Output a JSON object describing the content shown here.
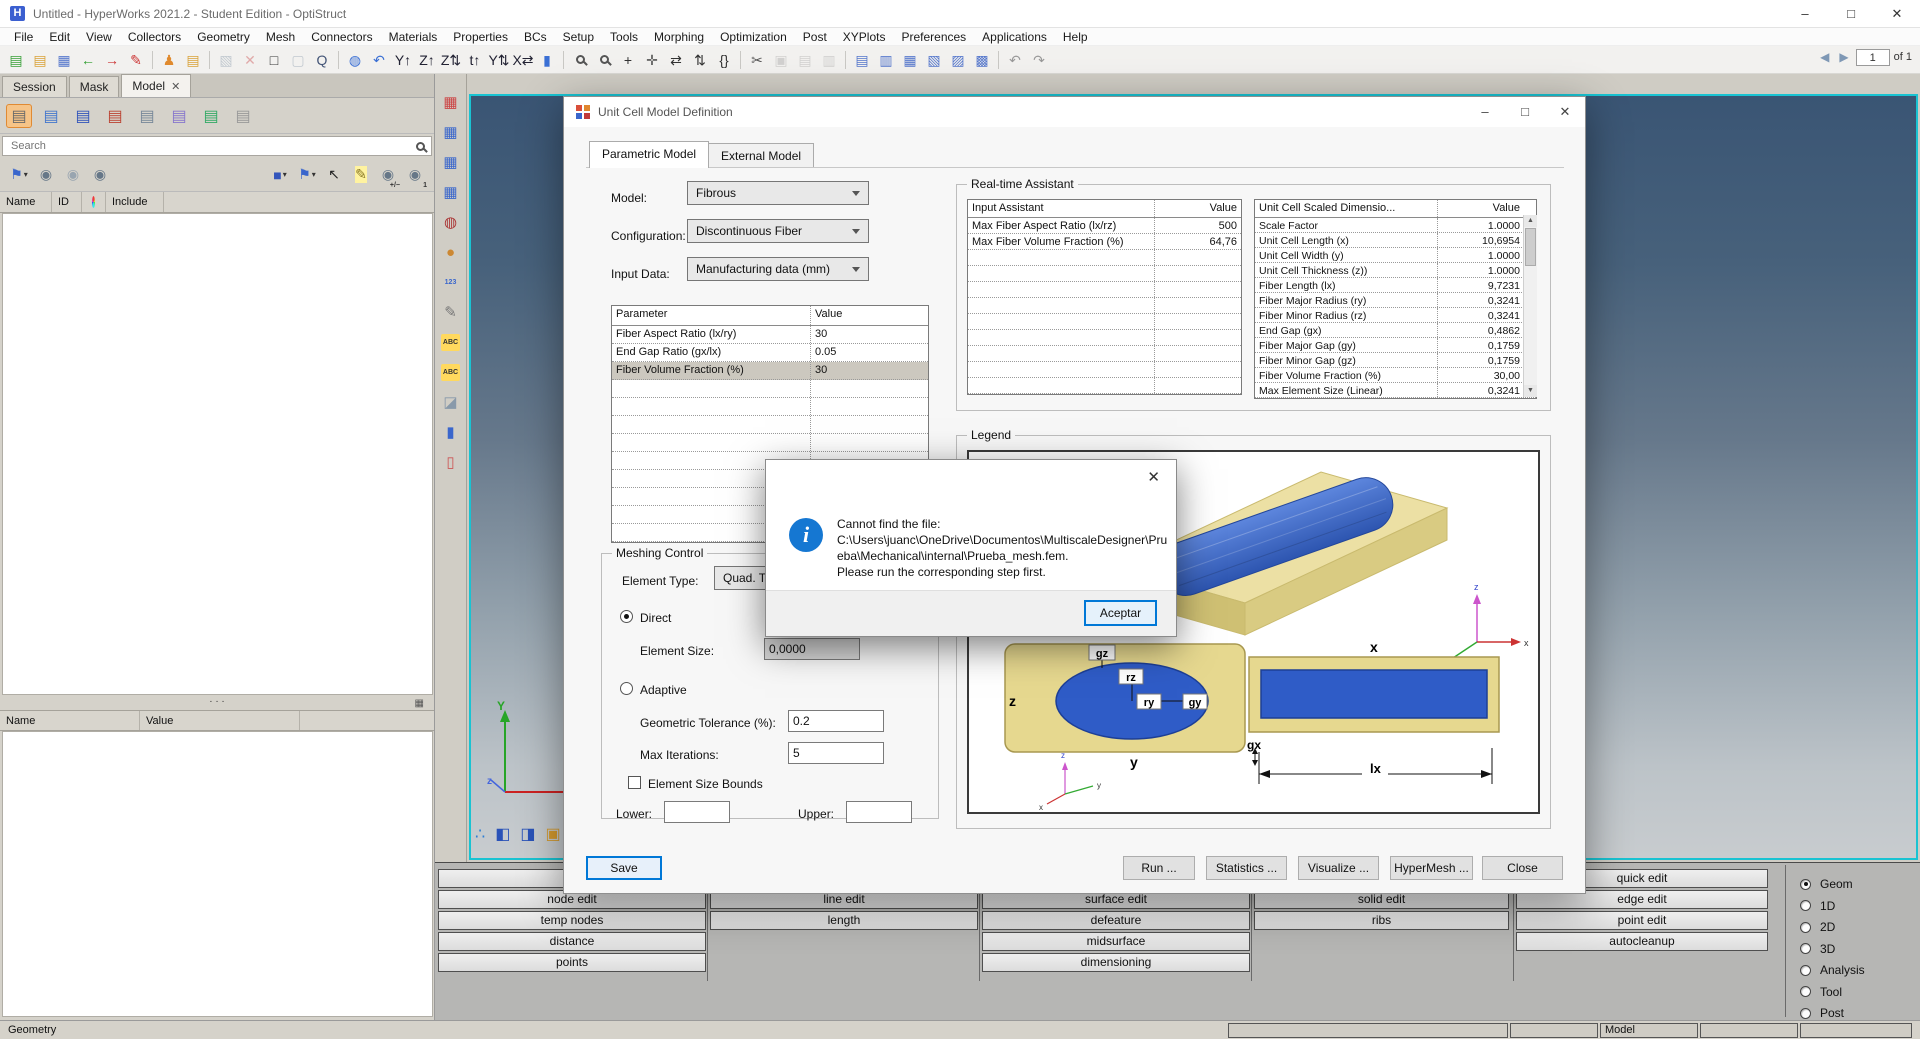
{
  "colors": {
    "accent_cyan": "#19c3d2",
    "focus_blue": "#0078d7",
    "info_blue": "#1577d2",
    "legend_yellow": "#e6d88f",
    "legend_blue": "#2f5cc7"
  },
  "window": {
    "title": "Untitled - HyperWorks 2021.2 - Student Edition - OptiStruct",
    "app_icon_glyph": "H",
    "controls": {
      "minimize": "–",
      "maximize": "□",
      "close": "✕"
    }
  },
  "menu": [
    "File",
    "Edit",
    "View",
    "Collectors",
    "Geometry",
    "Mesh",
    "Connectors",
    "Materials",
    "Properties",
    "BCs",
    "Setup",
    "Tools",
    "Morphing",
    "Optimization",
    "Post",
    "XYPlots",
    "Preferences",
    "Applications",
    "Help"
  ],
  "toolbar": {
    "icons": [
      {
        "n": "new-session-icon",
        "g": "▤",
        "c": "#3aa13a"
      },
      {
        "n": "open-file-icon",
        "g": "▤",
        "c": "#d9a33a"
      },
      {
        "n": "save-file-icon",
        "g": "▦",
        "c": "#5577cc"
      },
      {
        "n": "import-icon",
        "g": "←",
        "c": "#2e9e2e"
      },
      {
        "n": "export-icon",
        "g": "→",
        "c": "#cc3333"
      },
      {
        "n": "export-ppt-icon",
        "g": "✎",
        "c": "#cc3333"
      },
      {
        "sep": true
      },
      {
        "n": "user-profile-icon",
        "g": "♟",
        "c": "#e08a2e"
      },
      {
        "n": "organize-icon",
        "g": "▤",
        "c": "#d9a33a"
      },
      {
        "sep": true
      },
      {
        "n": "new-window-icon",
        "g": "▧",
        "c": "#8899aa",
        "dim": true
      },
      {
        "n": "delete-icon",
        "g": "✕",
        "c": "#cc5555",
        "dim": true
      },
      {
        "n": "display-rect-icon",
        "g": "□",
        "c": "#333333"
      },
      {
        "n": "panel-layout-icon",
        "g": "▢",
        "c": "#8899aa",
        "dim": true
      },
      {
        "n": "find-entities-icon",
        "g": "Q",
        "c": "#445577"
      },
      {
        "sep": true
      },
      {
        "n": "global-view-icon",
        "g": "◍",
        "c": "#3a6fd4"
      },
      {
        "n": "view-rotate-icon",
        "g": "↶",
        "c": "#3a6fd4"
      },
      {
        "n": "axis-view-y-icon",
        "g": "Y↑",
        "c": "#223"
      },
      {
        "n": "axis-view-z-icon",
        "g": "Z↑",
        "c": "#223"
      },
      {
        "n": "axis-view-zz-icon",
        "g": "Z⇅",
        "c": "#223"
      },
      {
        "n": "axis-view-t-icon",
        "g": "t↑",
        "c": "#223"
      },
      {
        "n": "axis-view-yz-icon",
        "g": "Y⇅",
        "c": "#223"
      },
      {
        "n": "axis-view-x-icon",
        "g": "X⇄",
        "c": "#223"
      },
      {
        "n": "notes-icon",
        "g": "▮",
        "c": "#3a6fd4"
      },
      {
        "sep": true
      },
      {
        "n": "zoom-icon",
        "mag": true
      },
      {
        "n": "zoom-area-icon",
        "mag": true
      },
      {
        "n": "fit-view-icon",
        "g": "+",
        "c": "#333"
      },
      {
        "n": "pan-icon",
        "g": "✛",
        "c": "#555"
      },
      {
        "n": "arrows-horizontal-icon",
        "g": "⇄",
        "c": "#333"
      },
      {
        "n": "arrows-vertical-icon",
        "g": "⇅",
        "c": "#333"
      },
      {
        "n": "braces-icon",
        "g": "{}",
        "c": "#333"
      },
      {
        "sep": true
      },
      {
        "n": "cut-icon",
        "g": "✂",
        "c": "#555"
      },
      {
        "n": "copy-icon",
        "g": "▣",
        "c": "#aaa",
        "dim": true
      },
      {
        "n": "paste-icon",
        "g": "▤",
        "c": "#aaa",
        "dim": true
      },
      {
        "n": "paste-special-icon",
        "g": "▥",
        "c": "#aaa",
        "dim": true
      },
      {
        "sep": true
      },
      {
        "n": "layout-single-icon",
        "g": "▤",
        "c": "#5577cc"
      },
      {
        "n": "layout-two-icon",
        "g": "▥",
        "c": "#5577cc"
      },
      {
        "n": "layout-grid-icon",
        "g": "▦",
        "c": "#5577cc"
      },
      {
        "n": "layout-left-icon",
        "g": "▧",
        "c": "#5577cc"
      },
      {
        "n": "layout-right-icon",
        "g": "▨",
        "c": "#5577cc"
      },
      {
        "n": "layout-quad-icon",
        "g": "▩",
        "c": "#5577cc"
      },
      {
        "sep": true
      },
      {
        "n": "undo-icon",
        "g": "↶",
        "c": "#999"
      },
      {
        "n": "redo-icon",
        "g": "↷",
        "c": "#999"
      }
    ],
    "nav": {
      "back": "◀",
      "forward": "▶",
      "page": "1",
      "of_label": "of 1"
    }
  },
  "vstrip_icons": [
    {
      "n": "model-table-icon",
      "g": "▦",
      "c": "#cc4444"
    },
    {
      "n": "mask-table-icon",
      "g": "▦",
      "c": "#3a66cc"
    },
    {
      "n": "matrix-table-icon",
      "g": "▦",
      "c": "#3a66cc"
    },
    {
      "n": "entity-table-icon",
      "g": "▦",
      "c": "#3a66cc"
    },
    {
      "n": "contact-browser-icon",
      "g": "◍",
      "c": "#aa3333"
    },
    {
      "n": "sphere-tool-icon",
      "g": "●",
      "c": "#cc8833"
    },
    {
      "n": "info-123-icon",
      "g": "123",
      "c": "#3a66cc",
      "small": true
    },
    {
      "n": "measure-icon",
      "g": "✎",
      "c": "#777"
    },
    {
      "n": "abc-highlight-icon",
      "g": "ABC",
      "c": "#333",
      "bg": "#ffd95e",
      "small": true
    },
    {
      "n": "abc-edit-icon",
      "g": "ABC",
      "c": "#333",
      "bg": "#ffd95e",
      "small": true
    },
    {
      "n": "section-cut-icon",
      "g": "◪",
      "c": "#8899aa"
    },
    {
      "n": "solver-view-icon",
      "g": "▮",
      "c": "#3a66cc"
    },
    {
      "n": "utility-icon",
      "g": "▯",
      "c": "#cc5555"
    }
  ],
  "sidebar": {
    "tabs": [
      {
        "label": "Session",
        "active": false
      },
      {
        "label": "Mask",
        "active": false
      },
      {
        "label": "Model",
        "active": true,
        "close_glyph": "✕"
      }
    ],
    "folder_icons": [
      {
        "n": "folder-new-icon",
        "g": "▤",
        "c": "#6a6a6a",
        "sel": true
      },
      {
        "n": "folder-connections-icon",
        "g": "▤",
        "c": "#4477cc"
      },
      {
        "n": "folder-component-icon",
        "g": "▤",
        "c": "#3355bb"
      },
      {
        "n": "folder-time-icon",
        "g": "▤",
        "c": "#bb4433"
      },
      {
        "n": "folder-mesh-icon",
        "g": "▤",
        "c": "#778899"
      },
      {
        "n": "folder-spline-icon",
        "g": "▤",
        "c": "#8877cc"
      },
      {
        "n": "folder-multi-icon",
        "g": "▤",
        "c": "#33aa66"
      },
      {
        "n": "folder-stack-icon",
        "g": "▤",
        "c": "#999999"
      }
    ],
    "search_placeholder": "Search",
    "row2_icons": [
      {
        "n": "model-view-icon",
        "g": "⚑",
        "c": "#3a66cc",
        "dd": true
      },
      {
        "n": "show-checked-icon",
        "g": "◉",
        "c": "#667788"
      },
      {
        "n": "show-unchecked-icon",
        "g": "◉",
        "c": "#99a5b0"
      },
      {
        "n": "show-reverse-icon",
        "g": "◉",
        "c": "#667788"
      },
      {
        "gap": true
      },
      {
        "n": "entity-display-icon",
        "g": "■",
        "c": "#3355bb",
        "dd": true
      },
      {
        "n": "view-flag-icon",
        "g": "⚑",
        "c": "#3a66cc",
        "dd": true
      },
      {
        "n": "pointer-icon",
        "g": "↖",
        "c": "#222"
      },
      {
        "n": "highlight-pen-icon",
        "g": "✎",
        "c": "#887722",
        "bg": "#fff3a0"
      },
      {
        "n": "show-hide-icon",
        "g": "◉",
        "c": "#667788",
        "sub": "+/−"
      },
      {
        "n": "isolate-one-icon",
        "g": "◉",
        "c": "#667788",
        "sub": "1"
      }
    ],
    "tree_headers": {
      "name": "Name",
      "id": "ID",
      "include": "Include"
    },
    "splitter_dots": "· · ·",
    "splitter_icon": "▦",
    "prop_headers": {
      "name": "Name",
      "value": "Value"
    }
  },
  "graphics": {
    "axis_y_label": "Y",
    "axis_z_label": "z",
    "tool_icons": [
      {
        "n": "spheres-cluster-icon",
        "g": "∴",
        "c": "#2e7fd4"
      },
      {
        "n": "blue-cubes-icon",
        "g": "◧",
        "c": "#2952b8"
      },
      {
        "n": "blue-cubes-alt-icon",
        "g": "◨",
        "c": "#2952b8"
      },
      {
        "n": "element-axes-icon",
        "g": "▣",
        "c": "#d49a2e"
      }
    ]
  },
  "dialog": {
    "title": "Unit Cell Model Definition",
    "controls": {
      "minimize": "–",
      "maximize": "□",
      "close": "✕"
    },
    "tabs": [
      {
        "label": "Parametric Model",
        "active": true
      },
      {
        "label": "External Model",
        "active": false
      }
    ],
    "fields": [
      {
        "label": "Model:",
        "value": "Fibrous"
      },
      {
        "label": "Configuration:",
        "value": "Discontinuous Fiber"
      },
      {
        "label": "Input Data:",
        "value": "Manufacturing data (mm)"
      }
    ],
    "param_table": {
      "headers": [
        "Parameter",
        "Value"
      ],
      "rows": [
        [
          "Fiber Aspect Ratio (lx/ry)",
          "30"
        ],
        [
          "End Gap Ratio (gx/lx)",
          "0.05"
        ],
        [
          "Fiber Volume Fraction (%)",
          "30"
        ]
      ],
      "selected_index": 2,
      "empty_rows": 9
    },
    "realtime": {
      "title": "Real-time Assistant",
      "input_table": {
        "headers": [
          "Input Assistant",
          "Value"
        ],
        "rows": [
          [
            "Max Fiber Aspect Ratio (lx/rz)",
            "500"
          ],
          [
            "Max Fiber Volume Fraction (%)",
            "64,76"
          ]
        ],
        "empty_rows": 9
      },
      "scaled_table": {
        "headers": [
          "Unit Cell Scaled Dimensio...",
          "Value"
        ],
        "rows": [
          [
            "Scale Factor",
            "1.0000"
          ],
          [
            "Unit Cell Length (x)",
            "10,6954"
          ],
          [
            "Unit Cell Width (y)",
            "1.0000"
          ],
          [
            "Unit Cell Thickness (z))",
            "1.0000"
          ],
          [
            "Fiber Length (lx)",
            "9,7231"
          ],
          [
            "Fiber Major Radius (ry)",
            "0,3241"
          ],
          [
            "Fiber Minor Radius (rz)",
            "0,3241"
          ],
          [
            "End Gap (gx)",
            "0,4862"
          ],
          [
            "Fiber Major Gap (gy)",
            "0,1759"
          ],
          [
            "Fiber Minor Gap (gz)",
            "0,1759"
          ],
          [
            "Fiber Volume Fraction (%)",
            "30,00"
          ],
          [
            "Max Element Size (Linear)",
            "0,3241"
          ]
        ]
      }
    },
    "legend": {
      "title": "Legend",
      "labels": {
        "gz": "gz",
        "rz": "rz",
        "ry": "ry",
        "gy": "gy",
        "z": "z",
        "y": "y",
        "x": "x",
        "gx": "gx",
        "lx": "lx"
      }
    },
    "meshing": {
      "title": "Meshing Control",
      "element_type_label": "Element Type:",
      "element_type_value": "Quad. Tet",
      "direct_label": "Direct",
      "element_size_label": "Element Size:",
      "element_size_value": "0,0000",
      "adaptive_label": "Adaptive",
      "geometric_tolerance_label": "Geometric Tolerance (%):",
      "geometric_tolerance_value": "0.2",
      "max_iterations_label": "Max Iterations:",
      "max_iterations_value": "5",
      "bounds_label": "Element Size Bounds",
      "lower_label": "Lower:",
      "upper_label": "Upper:"
    },
    "buttons": {
      "save": "Save",
      "run": "Run ...",
      "statistics": "Statistics ...",
      "visualize": "Visualize ...",
      "hypermesh": "HyperMesh ...",
      "close": "Close"
    }
  },
  "error_dialog": {
    "close_glyph": "✕",
    "info_glyph": "i",
    "message_lines": [
      "Cannot find the file:",
      "C:\\Users\\juanc\\OneDrive\\Documentos\\MultiscaleDesigner\\Prueba\\Mechanical\\internal\\Prueba_mesh.fem.",
      "Please run the corresponding step first."
    ],
    "ok_label": "Aceptar"
  },
  "bottom_panel": {
    "columns": [
      [
        "",
        "node edit",
        "temp nodes",
        "distance",
        "points"
      ],
      [
        "",
        "line edit",
        "length"
      ],
      [
        "",
        "surface edit",
        "defeature",
        "midsurface",
        "dimensioning"
      ],
      [
        null,
        "solid edit",
        "ribs"
      ],
      [
        "quick edit",
        "edge edit",
        "point edit",
        "autocleanup"
      ]
    ],
    "modes": [
      "Geom",
      "1D",
      "2D",
      "3D",
      "Analysis",
      "Tool",
      "Post"
    ],
    "selected_mode": "Geom"
  },
  "status_bar": {
    "left": "Geometry",
    "boxes": [
      "",
      "",
      "Model",
      "",
      ""
    ]
  }
}
